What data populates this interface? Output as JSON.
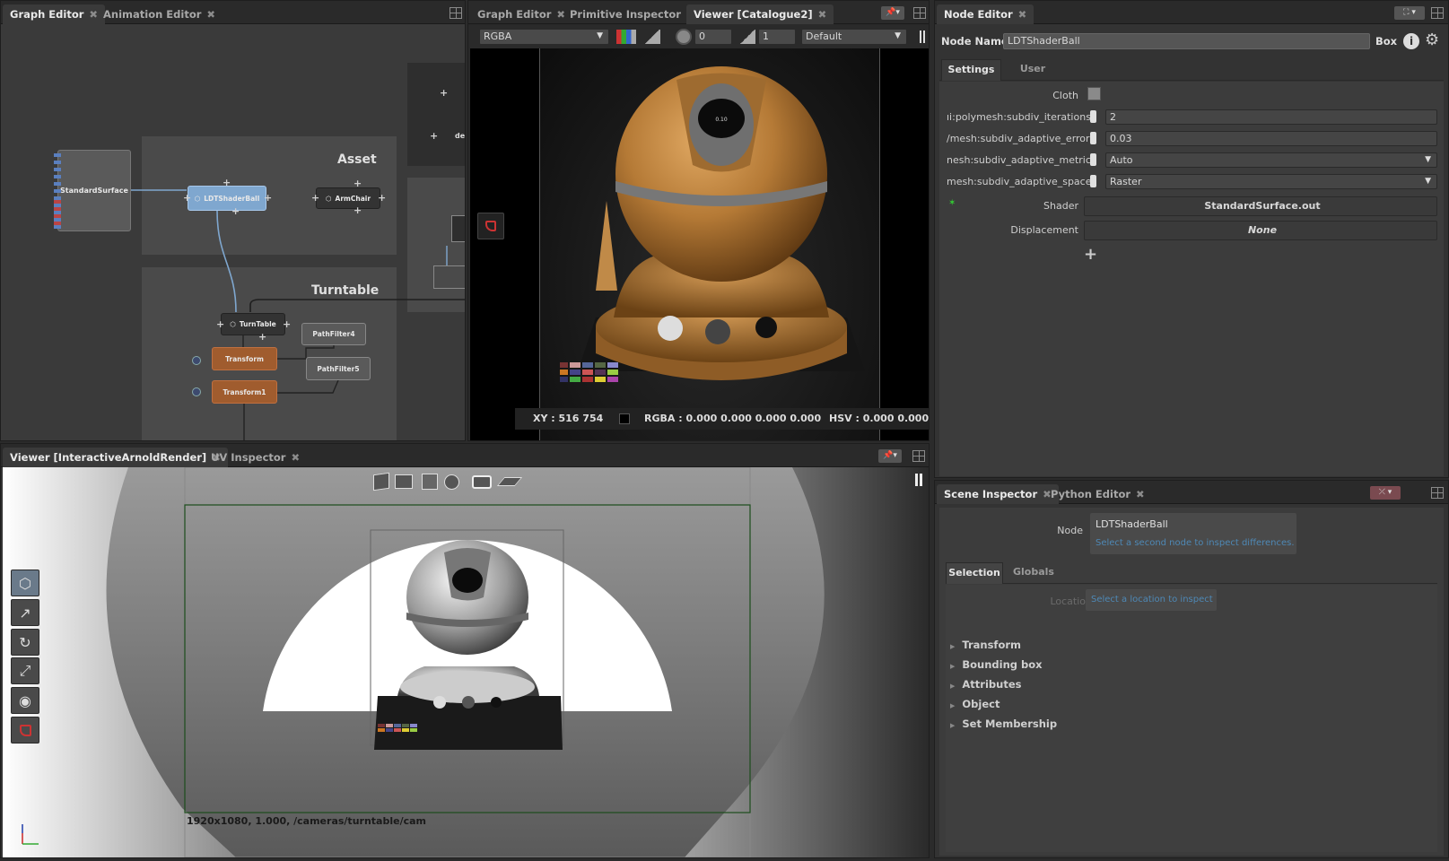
{
  "graph_panel": {
    "tabs": [
      {
        "label": "Graph Editor",
        "active": true
      },
      {
        "label": "Animation Editor",
        "active": false
      }
    ],
    "nodes": {
      "standard_surface": "StandardSurface",
      "shaderball": "LDTShaderBall",
      "armchair": "ArmChair",
      "turntable": "TurnTable",
      "pathfilter4": "PathFilter4",
      "pathfilter5": "PathFilter5",
      "transform": "Transform",
      "transform1": "Transform1",
      "partial_node": "de"
    },
    "groups": {
      "asset": "Asset",
      "turntable": "Turntable"
    }
  },
  "viewer_panel": {
    "tabs": [
      {
        "label": "Graph Editor",
        "active": false
      },
      {
        "label": "Primitive Inspector",
        "active": false
      },
      {
        "label": "Viewer [Catalogue2]",
        "active": true
      }
    ],
    "channel": "RGBA",
    "exposure": "0",
    "gamma": "1",
    "view_transform": "Default",
    "status": {
      "xy": "XY : 516 754",
      "rgba": "RGBA : 0.000 0.000 0.000 0.000",
      "hsv": "HSV : 0.000 0.000 0"
    },
    "render_label": "0.10"
  },
  "node_editor": {
    "tabs": [
      {
        "label": "Node Editor",
        "active": true
      }
    ],
    "node_name_label": "Node Name",
    "node_name": "LDTShaderBall",
    "node_type": "Box",
    "subtabs": [
      {
        "label": "Settings",
        "active": true
      },
      {
        "label": "User",
        "active": false
      }
    ],
    "params": {
      "cloth_label": "Cloth",
      "subdiv_iterations_label": "ıi:polymesh:subdiv_iterations",
      "subdiv_iterations": "2",
      "adaptive_error_label": "/mesh:subdiv_adaptive_error",
      "adaptive_error": "0.03",
      "adaptive_metric_label": "nesh:subdiv_adaptive_metric",
      "adaptive_metric": "Auto",
      "adaptive_space_label": "mesh:subdiv_adaptive_space",
      "adaptive_space": "Raster",
      "shader_label": "Shader",
      "shader": "StandardSurface.out",
      "displacement_label": "Displacement",
      "displacement": "None"
    }
  },
  "render_viewer": {
    "tabs": [
      {
        "label": "Viewer [InteractiveArnoldRender]",
        "active": true
      },
      {
        "label": "UV Inspector",
        "active": false
      }
    ],
    "camera_info": "1920x1080, 1.000, /cameras/turntable/cam"
  },
  "scene_inspector": {
    "tabs": [
      {
        "label": "Scene Inspector",
        "active": true
      },
      {
        "label": "Python Editor",
        "active": false
      }
    ],
    "node_label": "Node",
    "node_value": "LDTShaderBall",
    "second_node_hint": "Select a second node to inspect differences.",
    "subtabs": [
      {
        "label": "Selection",
        "active": true
      },
      {
        "label": "Globals",
        "active": false
      }
    ],
    "location_label": "Location",
    "location_hint": "Select a location to inspect",
    "sections": [
      "Transform",
      "Bounding box",
      "Attributes",
      "Object",
      "Set Membership"
    ]
  },
  "colors": {
    "accent": "#4e8fc8",
    "node_blue": "#7fa7cf",
    "node_orange": "#a05c2e",
    "gold": "#c38b45"
  }
}
